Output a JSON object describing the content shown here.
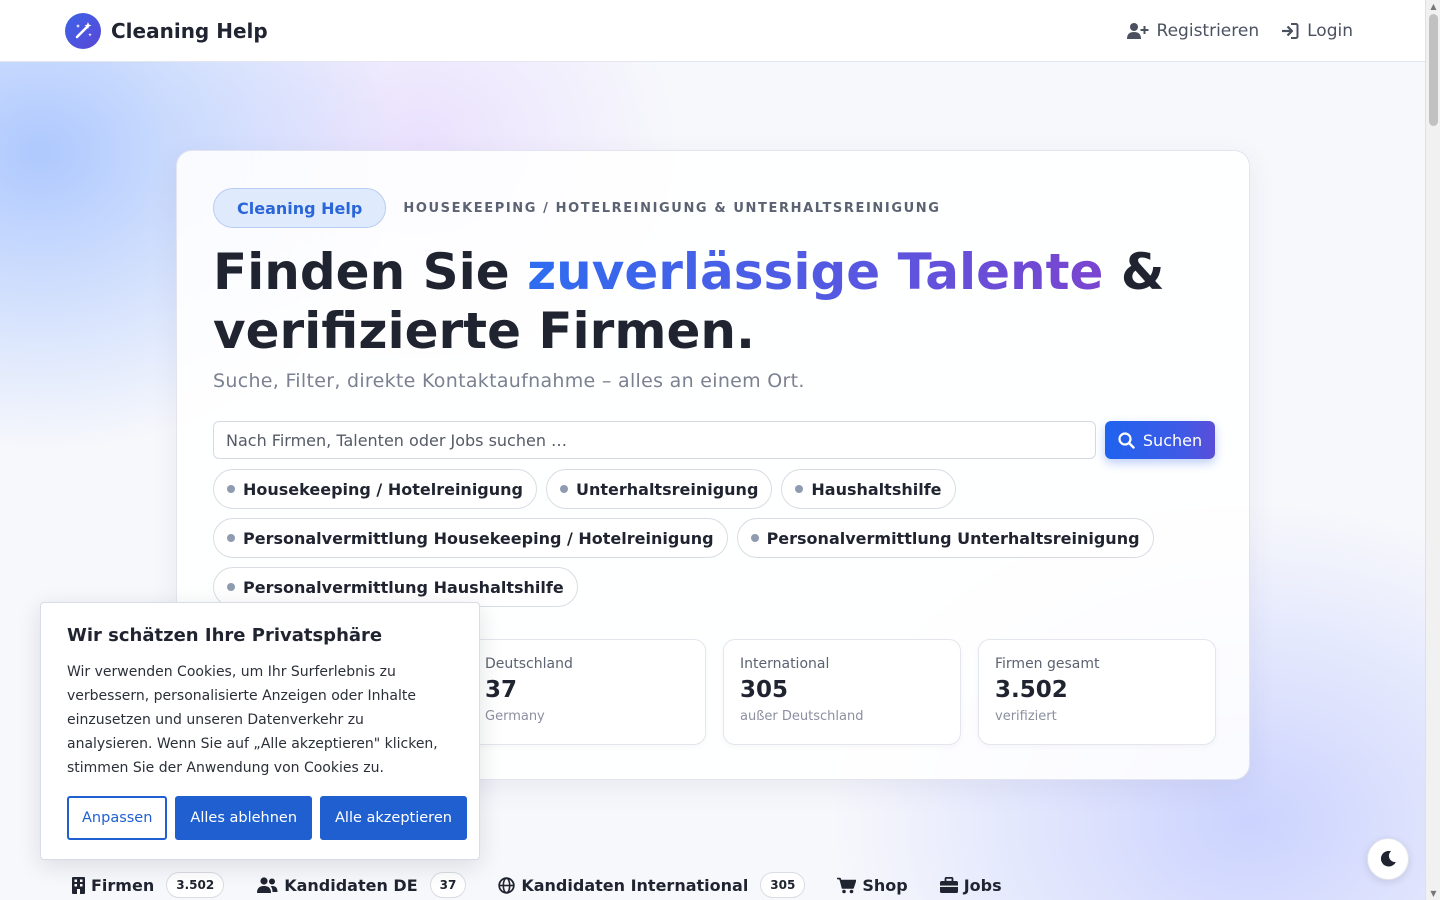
{
  "header": {
    "brand": "Cleaning Help",
    "register_label": "Registrieren",
    "login_label": "Login"
  },
  "hero": {
    "pill": "Cleaning Help",
    "eyebrow": "HOUSEKEEPING / HOTELREINIGUNG & UNTERHALTSREINIGUNG",
    "headline_pre": "Finden Sie ",
    "headline_highlight": "zuverlässige Talente",
    "headline_post": " & verifizierte Firmen.",
    "subline": "Suche, Filter, direkte Kontaktaufnahme – alles an einem Ort.",
    "search_placeholder": "Nach Firmen, Talenten oder Jobs suchen …",
    "search_button": "Suchen"
  },
  "chips": [
    "Housekeeping / Hotelreinigung",
    "Unterhaltsreinigung",
    "Haushaltshilfe",
    "Personalvermittlung Housekeeping / Hotelreinigung",
    "Personalvermittlung Unterhaltsreinigung",
    "Personalvermittlung Haushaltshilfe"
  ],
  "stats": [
    {
      "label": "Deutschland",
      "value": "37",
      "sub": "Germany"
    },
    {
      "label": "International",
      "value": "305",
      "sub": "außer Deutschland"
    },
    {
      "label": "Firmen gesamt",
      "value": "3.502",
      "sub": "verifiziert"
    }
  ],
  "cookie": {
    "title": "Wir schätzen Ihre Privatsphäre",
    "text": "Wir verwenden Cookies, um Ihr Surferlebnis zu verbessern, personalisierte Anzeigen oder Inhalte einzusetzen und unseren Datenverkehr zu analysieren. Wenn Sie auf „Alle akzeptieren\" klicken, stimmen Sie der Anwendung von Cookies zu.",
    "customize": "Anpassen",
    "reject": "Alles ablehnen",
    "accept": "Alle akzeptieren"
  },
  "tabs": [
    {
      "label": "Firmen",
      "count": "3.502",
      "icon": "building-icon"
    },
    {
      "label": "Kandidaten DE",
      "count": "37",
      "icon": "users-icon"
    },
    {
      "label": "Kandidaten International",
      "count": "305",
      "icon": "globe-icon"
    },
    {
      "label": "Shop",
      "icon": "cart-icon"
    },
    {
      "label": "Jobs",
      "icon": "briefcase-icon"
    }
  ],
  "colors": {
    "accent": "#1f63ee",
    "gradient_end": "#7a45cf",
    "cookie_button": "#1f5fd0"
  }
}
